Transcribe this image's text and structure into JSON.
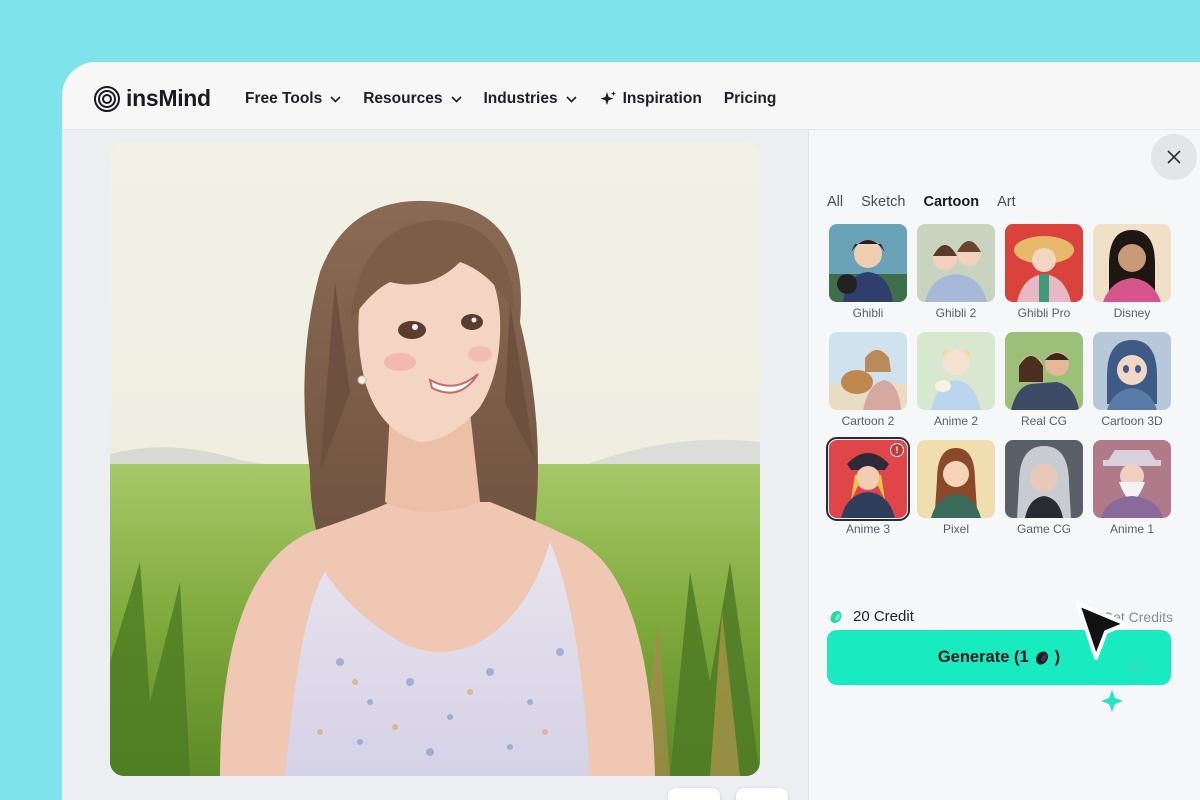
{
  "brand": {
    "name": "insMind"
  },
  "nav": {
    "items": [
      {
        "label": "Free Tools",
        "has_dropdown": true
      },
      {
        "label": "Resources",
        "has_dropdown": true
      },
      {
        "label": "Industries",
        "has_dropdown": true
      },
      {
        "label": "Inspiration",
        "has_dropdown": false,
        "icon": "sparkle-icon"
      },
      {
        "label": "Pricing",
        "has_dropdown": false
      }
    ]
  },
  "panel": {
    "tabs": [
      {
        "label": "All",
        "active": false
      },
      {
        "label": "Sketch",
        "active": false
      },
      {
        "label": "Cartoon",
        "active": true
      },
      {
        "label": "Art",
        "active": false
      }
    ],
    "styles": [
      {
        "label": "Ghibli"
      },
      {
        "label": "Ghibli 2"
      },
      {
        "label": "Ghibli Pro"
      },
      {
        "label": "Disney"
      },
      {
        "label": "Cartoon 2"
      },
      {
        "label": "Anime 2"
      },
      {
        "label": "Real CG"
      },
      {
        "label": "Cartoon 3D"
      },
      {
        "label": "Anime 3",
        "selected": true
      },
      {
        "label": "Pixel"
      },
      {
        "label": "Game CG"
      },
      {
        "label": "Anime 1"
      }
    ],
    "credits": {
      "amount": "20 Credit",
      "get_label": "Get Credits"
    },
    "generate": {
      "label_prefix": "Generate (1",
      "label_suffix": ")"
    }
  },
  "tools": {
    "compare_icon": "compare-icon",
    "upload_icon": "upload-icon"
  },
  "colors": {
    "background": "#7ee3ea",
    "accent": "#19ebc1",
    "window": "#f4f5f7"
  }
}
